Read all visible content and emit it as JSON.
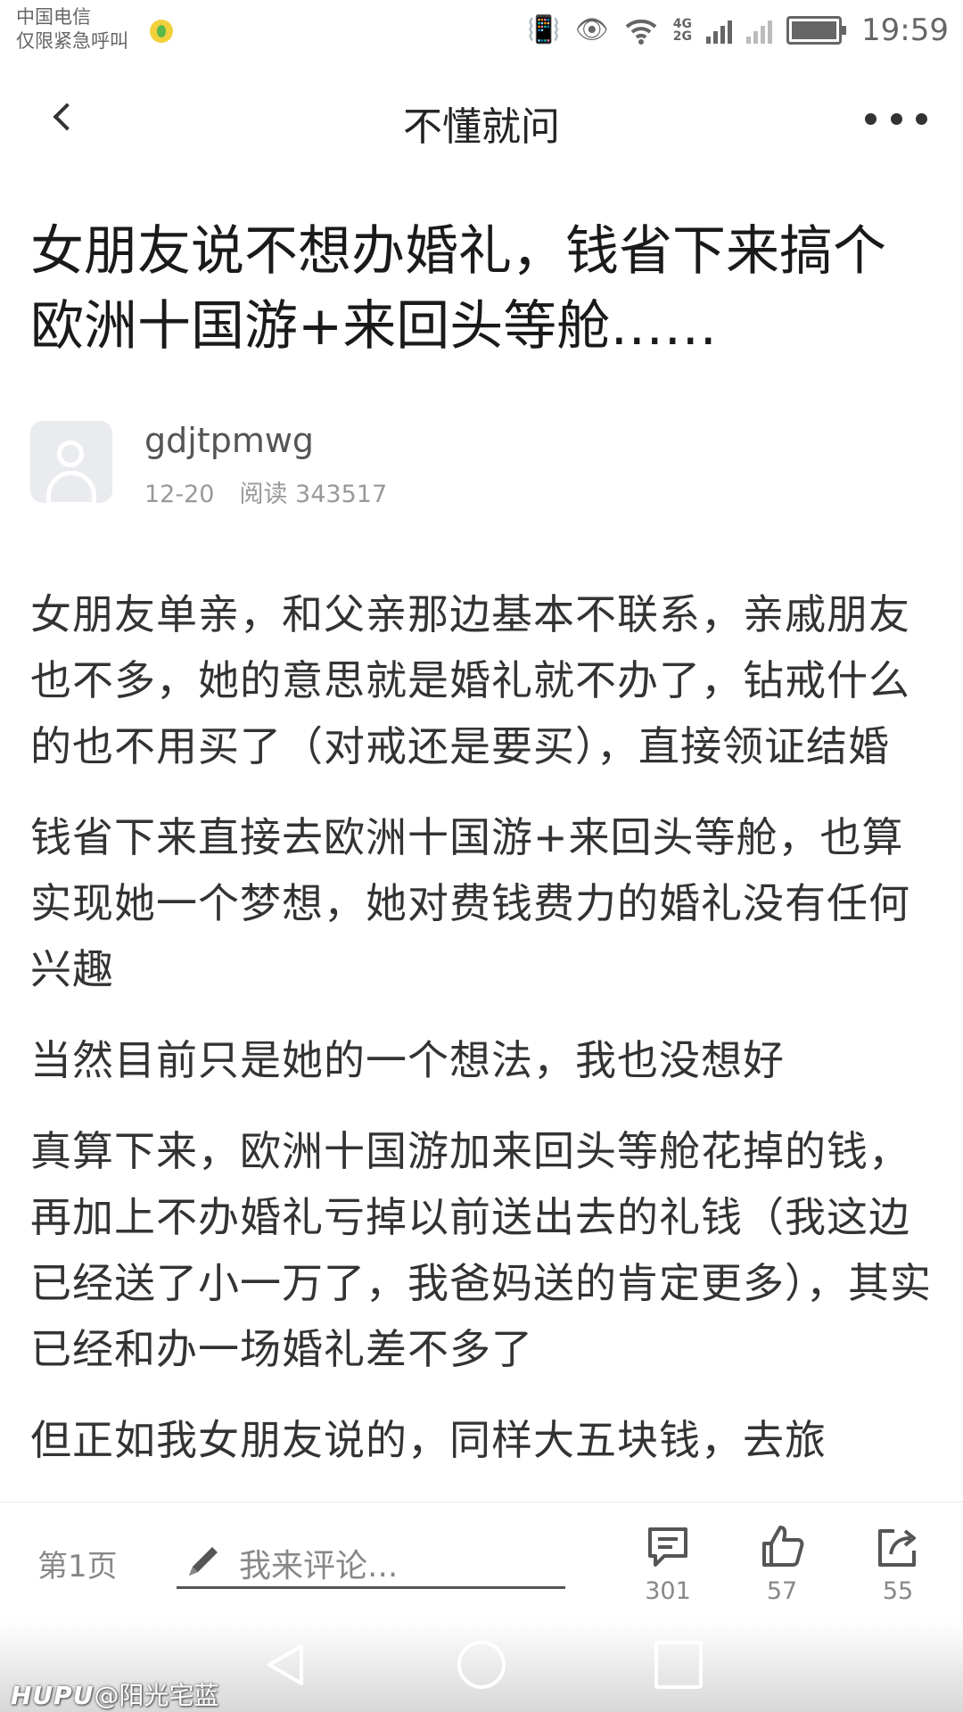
{
  "status_bar": {
    "carrier_line1": "中国电信",
    "carrier_line2": "仅限紧急呼叫",
    "net_4g": "4G",
    "net_2g": "2G",
    "time": "19:59"
  },
  "nav": {
    "title": "不懂就问"
  },
  "post": {
    "title": "女朋友说不想办婚礼，钱省下来搞个欧洲十国游+来回头等舱……",
    "author": "gdjtpmwg",
    "date": "12-20",
    "reads": "阅读 343517",
    "paragraphs": [
      "女朋友单亲，和父亲那边基本不联系，亲戚朋友也不多，她的意思就是婚礼就不办了，钻戒什么的也不用买了（对戒还是要买），直接领证结婚",
      "钱省下来直接去欧洲十国游+来回头等舱，也算实现她一个梦想，她对费钱费力的婚礼没有任何兴趣",
      "当然目前只是她的一个想法，我也没想好",
      "真算下来，欧洲十国游加来回头等舱花掉的钱，再加上不办婚礼亏掉以前送出去的礼钱（我这边已经送了小一万了，我爸妈送的肯定更多），其实已经和办一场婚礼差不多了",
      "但正如我女朋友说的，同样大五块钱，去旅"
    ]
  },
  "action_bar": {
    "page": "第1页",
    "comment_placeholder": "我来评论...",
    "comments_count": "301",
    "likes_count": "57",
    "shares_count": "55"
  },
  "watermark": {
    "brand": "HUPU",
    "user": "@阳光宅蓝"
  }
}
